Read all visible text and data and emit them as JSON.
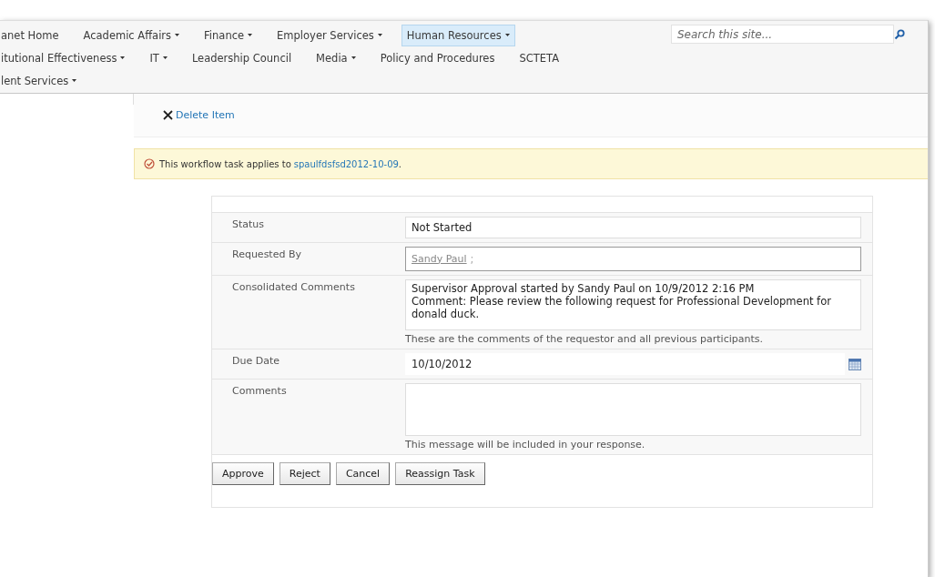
{
  "nav": {
    "rows": [
      [
        {
          "label": "anet Home",
          "has_menu": false,
          "selected": false
        },
        {
          "label": "Academic Affairs",
          "has_menu": true,
          "selected": false
        },
        {
          "label": "Finance",
          "has_menu": true,
          "selected": false
        },
        {
          "label": "Employer Services",
          "has_menu": true,
          "selected": false
        },
        {
          "label": "Human Resources",
          "has_menu": true,
          "selected": true
        }
      ],
      [
        {
          "label": "itutional Effectiveness",
          "has_menu": true,
          "selected": false
        },
        {
          "label": "IT",
          "has_menu": true,
          "selected": false
        },
        {
          "label": "Leadership Council",
          "has_menu": false,
          "selected": false
        },
        {
          "label": "Media",
          "has_menu": true,
          "selected": false
        },
        {
          "label": "Policy and Procedures",
          "has_menu": false,
          "selected": false
        },
        {
          "label": "SCTETA",
          "has_menu": false,
          "selected": false
        }
      ],
      [
        {
          "label": "lent Services",
          "has_menu": true,
          "selected": false
        }
      ]
    ],
    "search": {
      "placeholder": "Search this site..."
    }
  },
  "toolbar": {
    "delete_label": "Delete Item"
  },
  "notice": {
    "text": "This workflow task applies to",
    "link": "spaulfdsfsd2012-10-09",
    "tail": "."
  },
  "form": {
    "rows": [
      {
        "kind": "text",
        "label": "Status",
        "value": "Not Started"
      },
      {
        "kind": "people",
        "label": "Requested By",
        "value": "Sandy Paul",
        "separator": ";"
      },
      {
        "kind": "multiline",
        "label": "Consolidated Comments",
        "lines": [
          "Supervisor Approval  started by Sandy Paul on 10/9/2012 2:16 PM",
          "Comment: Please review the following request for Professional Development for donald duck."
        ],
        "hint": "These are the comments of the requestor and all previous participants."
      },
      {
        "kind": "date",
        "label": "Due Date",
        "value": "10/10/2012"
      },
      {
        "kind": "textarea",
        "label": "Comments",
        "hint": "This message will be included in your response."
      }
    ],
    "buttons": [
      "Approve",
      "Reject",
      "Cancel",
      "Reassign Task"
    ]
  }
}
